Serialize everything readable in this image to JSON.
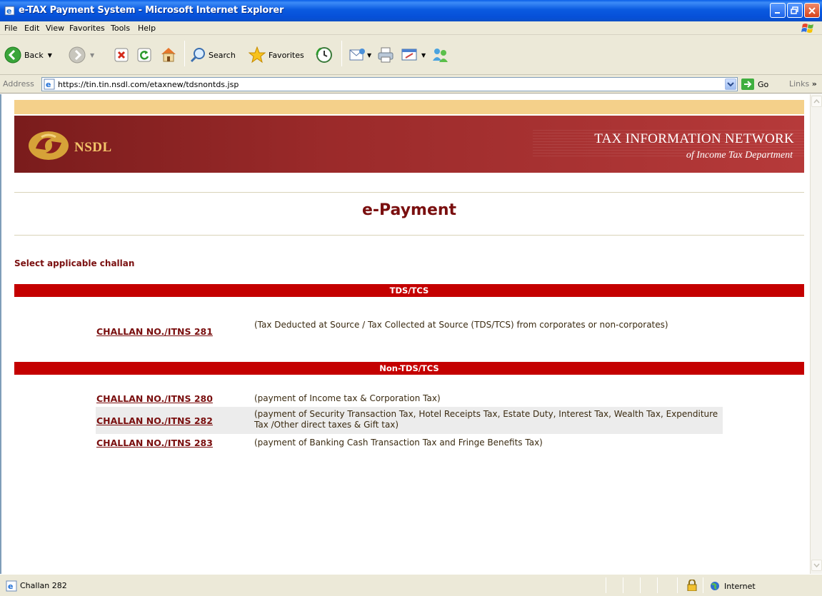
{
  "window": {
    "title": "e-TAX Payment System - Microsoft Internet Explorer"
  },
  "menu": [
    "File",
    "Edit",
    "View",
    "Favorites",
    "Tools",
    "Help"
  ],
  "toolbar": {
    "back_label": "Back",
    "search_label": "Search",
    "favorites_label": "Favorites"
  },
  "address": {
    "label": "Address",
    "url": "https://tin.tin.nsdl.com/etaxnew/tdsnontds.jsp",
    "go_label": "Go",
    "links_label": "Links"
  },
  "banner": {
    "brand": "NSDL",
    "title": "TAX INFORMATION NETWORK",
    "subtitle": "of Income Tax Department"
  },
  "page": {
    "heading": "e-Payment",
    "select_label": "Select applicable challan"
  },
  "sections": [
    {
      "title": "TDS/TCS",
      "items": [
        {
          "link": "CHALLAN NO./ITNS 281",
          "description": "(Tax Deducted at Source / Tax Collected at Source (TDS/TCS) from corporates or non-corporates)"
        }
      ]
    },
    {
      "title": "Non-TDS/TCS",
      "items": [
        {
          "link": "CHALLAN NO./ITNS 280",
          "description": "(payment of Income tax & Corporation Tax)"
        },
        {
          "link": "CHALLAN NO./ITNS 282",
          "description": "(payment of Security Transaction Tax, Hotel Receipts Tax, Estate Duty, Interest Tax, Wealth Tax, Expenditure Tax /Other direct taxes & Gift tax)"
        },
        {
          "link": "CHALLAN NO./ITNS 283",
          "description": "(payment of Banking Cash Transaction Tax and Fringe Benefits Tax)"
        }
      ]
    }
  ],
  "status": {
    "text": "Challan 282",
    "zone": "Internet"
  },
  "colors": {
    "title_bar": "#0a5ae0",
    "section_bar": "#c40000",
    "heading": "#7a0f0f",
    "banner": "#9b2a2a",
    "banner_strip": "#f4d08a"
  }
}
